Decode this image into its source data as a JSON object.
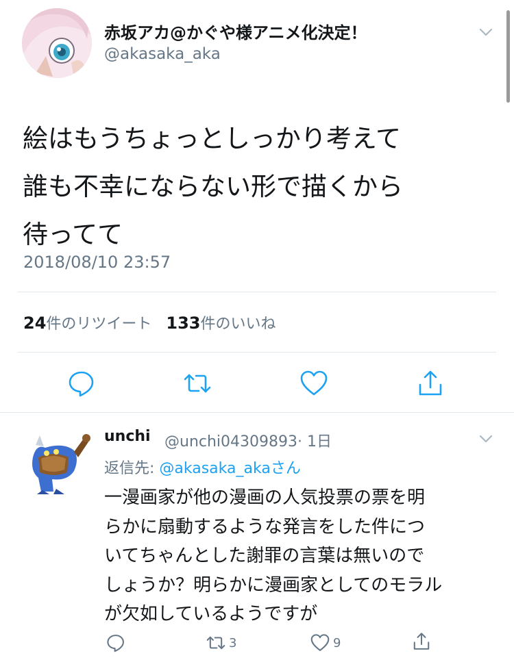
{
  "tweet": {
    "author_name": "赤坂アカ@かぐや様アニメ化決定！",
    "author_handle": "@akasaka_aka",
    "text_lines": [
      "絵はもうちょっとしっかり考えて",
      "誰も不幸にならない形で描くから",
      "待ってて"
    ],
    "timestamp": "2018/08/10 23:57",
    "retweet_count": "24",
    "retweet_label": "件のリツイート",
    "like_count": "133",
    "like_label": "件のいいね"
  },
  "reply": {
    "author_name": "unchi",
    "author_handle": "@unchi04309893",
    "time": "· 1日",
    "replying_prefix": "返信先: ",
    "replying_to": "@akasaka_akaさん",
    "text_lines": [
      "一漫画家が他の漫画の人気投票の票を明",
      "らかに扇動するような発言をした件につ",
      "いてちゃんとした謝罪の言葉は無いので",
      "しょうか？明らかに漫画家としてのモラル",
      "が欠如しているようですが"
    ],
    "retweet_count": "3",
    "like_count": "9"
  },
  "icons": {
    "menu": "chevron-down-icon",
    "reply": "reply-icon",
    "retweet": "retweet-icon",
    "like": "heart-icon",
    "share": "share-icon"
  },
  "colors": {
    "primary_text": "#14171a",
    "secondary_text": "#657786",
    "link": "#1da1f2",
    "divider": "#e1e8ed",
    "action_icon": "#1da1f2"
  }
}
